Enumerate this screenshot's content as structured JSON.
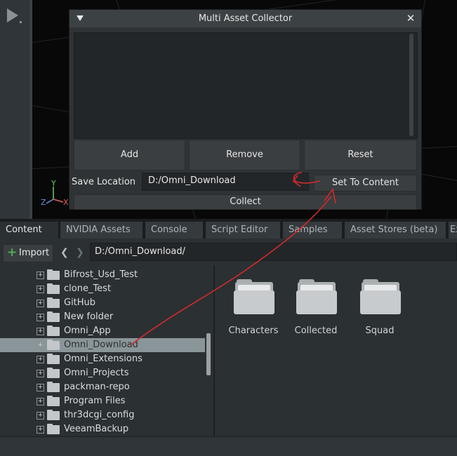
{
  "window": {
    "title": "Multi Asset Collector",
    "close_glyph": "✕",
    "buttons": {
      "add": "Add",
      "remove": "Remove",
      "reset": "Reset"
    },
    "save_location_label": "Save Location",
    "save_location_value": "D:/Omni_Download",
    "set_to_content": "Set To Content",
    "collect": "Collect"
  },
  "viewport": {
    "axes": {
      "x": "X",
      "y": "Y",
      "z": "Z"
    }
  },
  "tabs": [
    {
      "label": "Content"
    },
    {
      "label": "NVIDIA Assets"
    },
    {
      "label": "Console"
    },
    {
      "label": "Script Editor"
    },
    {
      "label": "Samples"
    },
    {
      "label": "Asset Stores (beta)"
    },
    {
      "label": "Ex"
    }
  ],
  "toolbar": {
    "import_label": "Import",
    "path": "D:/Omni_Download/",
    "back_glyph": "❮",
    "forward_glyph": "❯"
  },
  "tree": {
    "items": [
      {
        "label": "Bifrost_Usd_Test"
      },
      {
        "label": "clone_Test"
      },
      {
        "label": "GitHub"
      },
      {
        "label": "New folder"
      },
      {
        "label": "Omni_App"
      },
      {
        "label": "Omni_Download"
      },
      {
        "label": "Omni_Extensions"
      },
      {
        "label": "Omni_Projects"
      },
      {
        "label": "packman-repo"
      },
      {
        "label": "Program Files"
      },
      {
        "label": "thr3dcgi_config"
      },
      {
        "label": "VeeamBackup"
      }
    ]
  },
  "grid": {
    "items": [
      {
        "label": "Characters"
      },
      {
        "label": "Collected"
      },
      {
        "label": "Squad"
      }
    ]
  },
  "colors": {
    "annotation": "#d42a2a",
    "accent_green": "#4caf50",
    "selected_row": "#8a9599"
  }
}
